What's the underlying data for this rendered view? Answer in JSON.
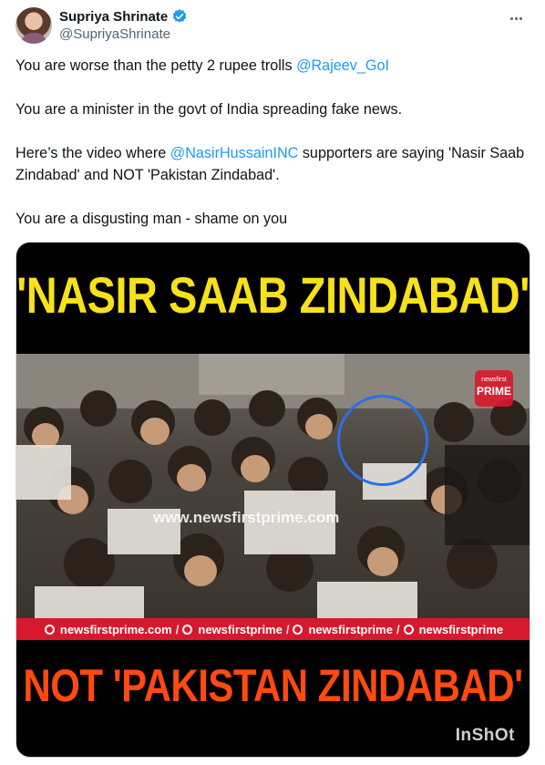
{
  "author": {
    "display_name": "Supriya Shrinate",
    "handle": "@SupriyaShrinate",
    "verified": true,
    "verified_color": "#1d9bf0",
    "avatar_icon": "profile-photo",
    "more_icon": "more-options-icon"
  },
  "tweet": {
    "line1_text": "You are worse than the petty 2 rupee trolls ",
    "line1_mention": "@Rajeev_GoI",
    "line2_text": "You are a minister in the govt of India spreading fake news.",
    "line3_prefix": "Here’s the video where  ",
    "line3_mention": "@NasirHussainINC",
    "line3_suffix": " supporters are saying 'Nasir Saab Zindabad' and NOT 'Pakistan Zindabad'.",
    "line4_text": "You are a disgusting man - shame on you",
    "mention_color": "#1d9bf0"
  },
  "media": {
    "top_caption": "'NASIR SAAB ZINDABAD'",
    "top_caption_color": "#f7e11b",
    "bottom_caption": "NOT  'PAKISTAN ZINDABAD'",
    "bottom_caption_color": "#ff4a11",
    "video_watermark": "www.newsfirstprime.com",
    "channel_logo_top": "newsfirst",
    "channel_logo_bottom": "PRIME",
    "social_items": [
      "newsfirstprime.com",
      "newsfirstprime",
      "newsfirstprime",
      "newsfirstprime"
    ],
    "social_bar_color": "#d7192d",
    "editor_watermark": "InShOt"
  }
}
